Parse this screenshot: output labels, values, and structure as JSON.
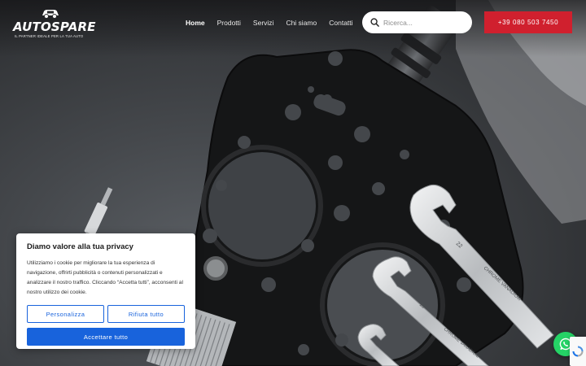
{
  "brand": {
    "logo_name_auto": "AUTO",
    "logo_name_spare": "SPARE",
    "tagline": "IL PARTNER IDEALE PER LA TUA AUTO"
  },
  "nav": {
    "items": [
      {
        "label": "Home",
        "active": true
      },
      {
        "label": "Prodotti",
        "active": false
      },
      {
        "label": "Servizi",
        "active": false
      },
      {
        "label": "Chi siamo",
        "active": false
      },
      {
        "label": "Contatti",
        "active": false
      }
    ]
  },
  "search": {
    "placeholder": "Ricerca..."
  },
  "phone": {
    "label": "+39 080 503 7450"
  },
  "cookie": {
    "title": "Diamo valore alla tua privacy",
    "body": "Utilizziamo i cookie per migliorare la tua esperienza di navigazione, offrirti pubblicità o contenuti personalizzati e analizzare il nostro traffico. Cliccando “Accetta tutti”, acconsenti al nostro utilizzo dei cookie.",
    "customize_label": "Personalizza",
    "reject_label": "Rifiuta tutto",
    "accept_label": "Accettare tutto"
  },
  "hero": {
    "wrench_texts": [
      "22",
      "CHROME VANADIUM",
      "15",
      "CHROME VANADIUM"
    ]
  },
  "colors": {
    "accent_red": "#d0202e",
    "cookie_blue": "#1863dc",
    "whatsapp_green": "#25d366"
  },
  "icons": {
    "search": "search-icon",
    "whatsapp": "whatsapp-icon",
    "recaptcha": "recaptcha-icon",
    "logo": "car-logo-icon"
  }
}
